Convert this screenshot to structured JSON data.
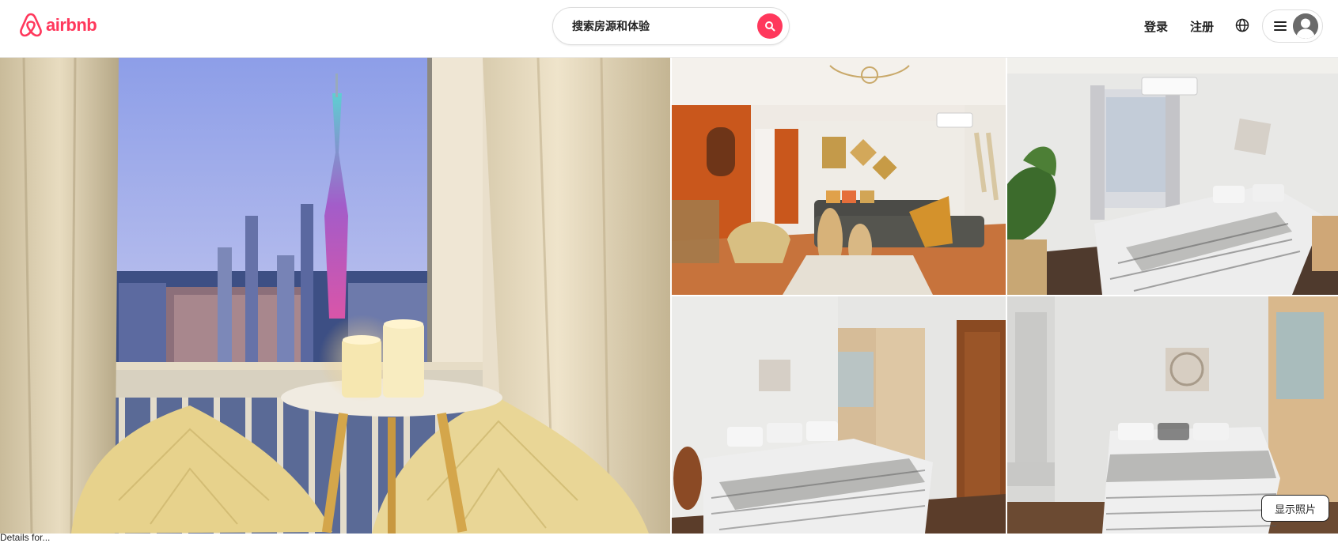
{
  "brand": {
    "name": "airbnb",
    "color": "#ff385c",
    "icon": "airbnb-belo-icon"
  },
  "search": {
    "label": "搜索房源和体验",
    "icon": "search-icon",
    "button_color": "#ff385c"
  },
  "nav": {
    "login": "登录",
    "signup": "注册",
    "language_icon": "globe-icon",
    "menu_icon": "hamburger-menu-icon",
    "avatar_icon": "user-avatar-icon"
  },
  "gallery": {
    "photos": [
      {
        "name": "main-photo",
        "subject": "window view of Canton Tower with candles and pillows"
      },
      {
        "name": "photo-2",
        "subject": "living room with orange wall and grey sofa"
      },
      {
        "name": "photo-3",
        "subject": "bedroom with plant and window"
      },
      {
        "name": "photo-4",
        "subject": "bedroom with wooden door and wardrobe"
      },
      {
        "name": "photo-5",
        "subject": "bedroom with mandala wall art"
      }
    ],
    "show_photos_label": "显示照片"
  },
  "footer": {
    "text": "Details for..."
  }
}
